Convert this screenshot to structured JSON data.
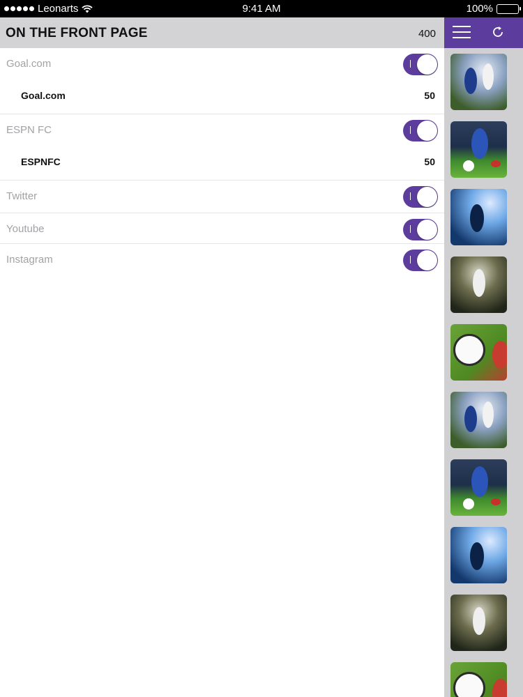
{
  "statusbar": {
    "carrier": "Leonarts",
    "time": "9:41 AM",
    "battery": "100%"
  },
  "header": {
    "title": "ON THE FRONT PAGE",
    "count": "400"
  },
  "sources": [
    {
      "label": "Goal.com",
      "enabled": true,
      "sub": {
        "label": "Goal.com",
        "value": "50"
      }
    },
    {
      "label": "ESPN FC",
      "enabled": true,
      "sub": {
        "label": "ESPNFC",
        "value": "50"
      }
    },
    {
      "label": "Twitter",
      "enabled": true
    },
    {
      "label": "Youtube",
      "enabled": true
    },
    {
      "label": "Instagram",
      "enabled": true
    }
  ],
  "sidebar": {
    "menu_icon": "hamburger-menu-icon",
    "refresh_icon": "refresh-icon",
    "thumbnails": [
      "soccer-photo",
      "soccer-photo",
      "soccer-photo",
      "soccer-photo",
      "soccer-photo",
      "soccer-photo",
      "soccer-photo",
      "soccer-photo",
      "soccer-photo",
      "soccer-photo"
    ]
  },
  "colors": {
    "accent": "#5c3c9c",
    "header_bg": "#d3d3d5",
    "sidebar_bg": "#d0d0d2"
  }
}
